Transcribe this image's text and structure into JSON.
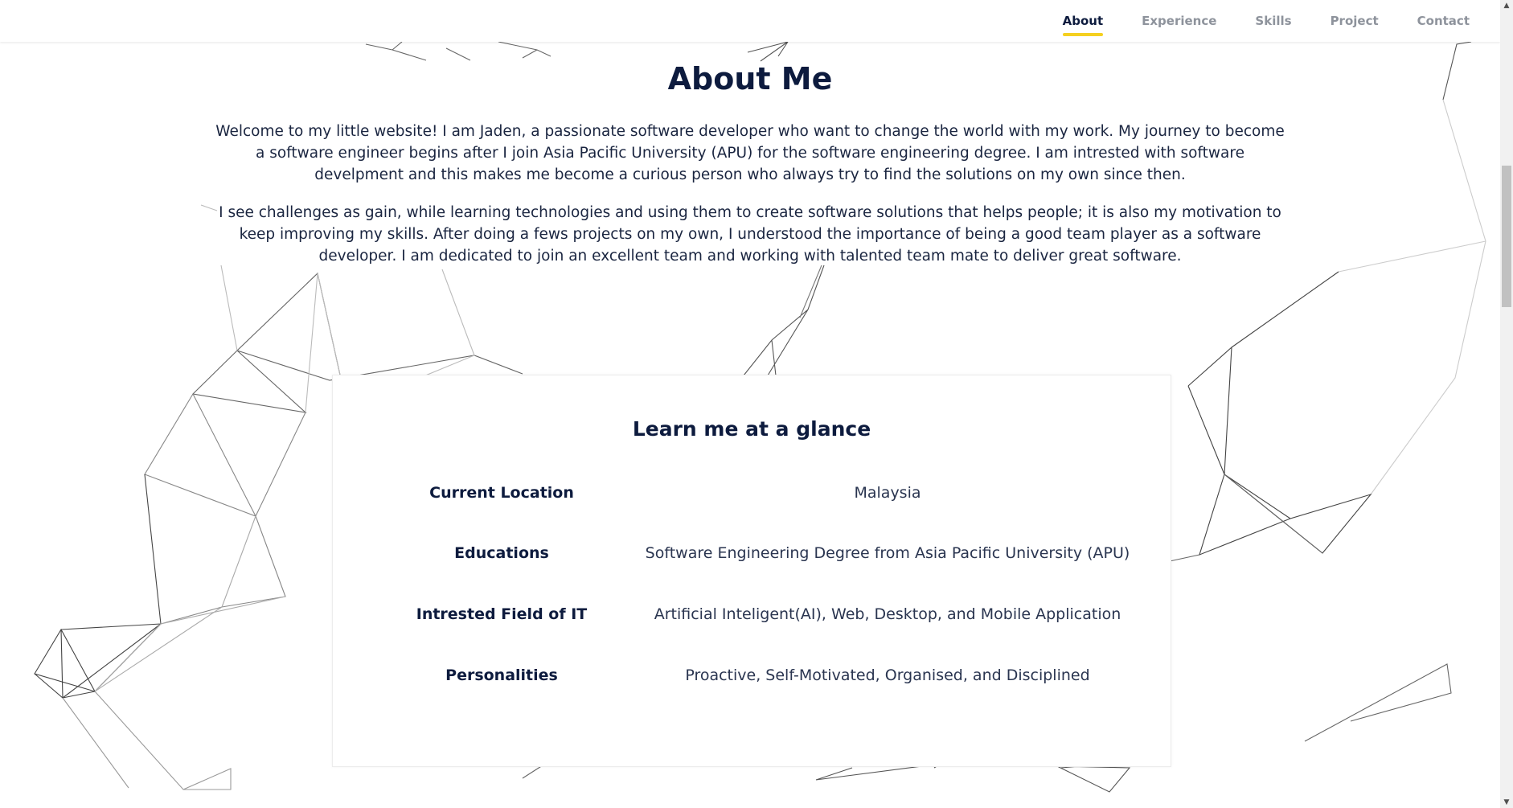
{
  "nav": {
    "items": [
      {
        "label": "About",
        "active": true
      },
      {
        "label": "Experience",
        "active": false
      },
      {
        "label": "Skills",
        "active": false
      },
      {
        "label": "Project",
        "active": false
      },
      {
        "label": "Contact",
        "active": false
      }
    ]
  },
  "about": {
    "title": "About Me",
    "paragraph1": "Welcome to my little website! I am Jaden, a passionate software developer who want to change the world with my work. My journey to become a software engineer begins after I join Asia Pacific University (APU) for the software engineering degree. I am intrested with software develpment and this makes me become a curious person who always try to find the solutions on my own since then.",
    "paragraph2": "I see challenges as gain, while learning technologies and using them to create software solutions that helps people; it is also my motivation to keep improving my skills. After doing a fews projects on my own, I understood the importance of being a good team player as a software developer. I am dedicated to join an excellent team and working with talented team mate to deliver great software."
  },
  "glance": {
    "title": "Learn me at a glance",
    "rows": [
      {
        "label": "Current Location",
        "value": "Malaysia"
      },
      {
        "label": "Educations",
        "value": "Software Engineering Degree from Asia Pacific University (APU)"
      },
      {
        "label": "Intrested Field of IT",
        "value": "Artificial Inteligent(AI), Web, Desktop, and Mobile Application"
      },
      {
        "label": "Personalities",
        "value": "Proactive, Self-Motivated, Organised, and Disciplined"
      }
    ]
  },
  "colors": {
    "primary_text": "#0d1b3e",
    "muted_nav": "#8e939c",
    "accent_underline": "#f5d020",
    "background": "#ffffff"
  },
  "scrollbar": {
    "up_icon": "chevron-up-icon",
    "down_icon": "chevron-down-icon"
  }
}
